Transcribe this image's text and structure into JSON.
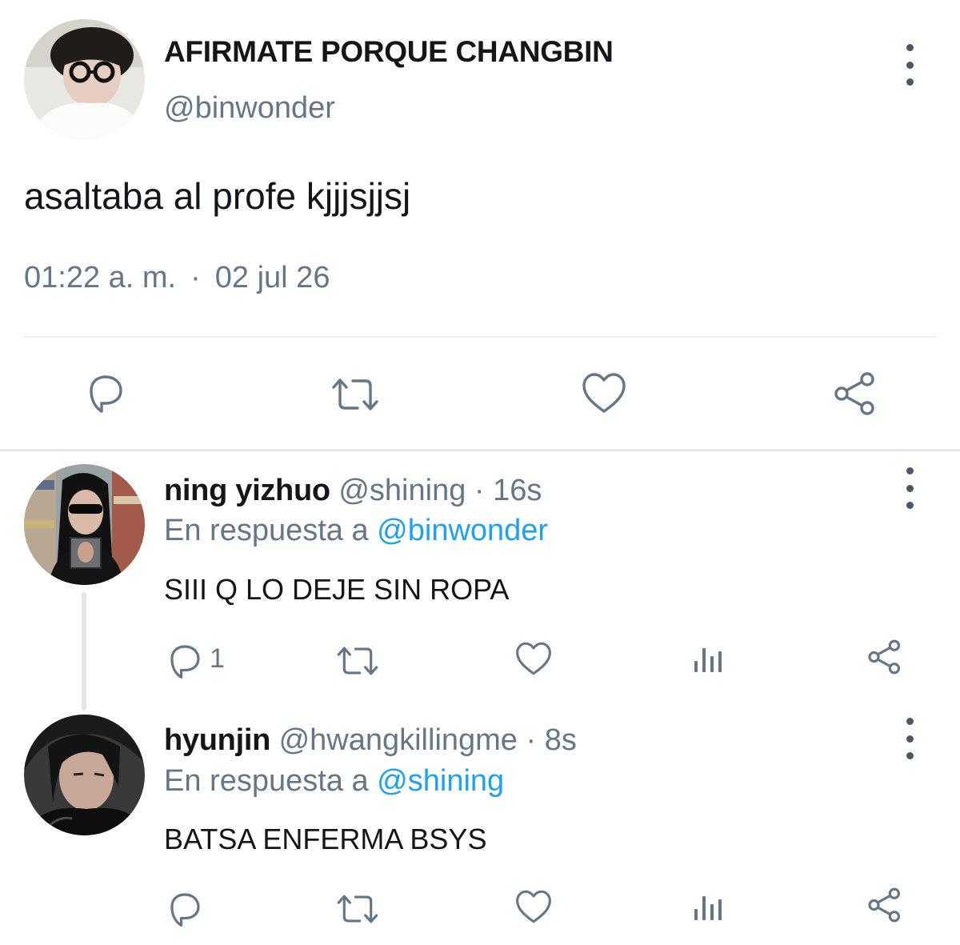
{
  "main_tweet": {
    "display_name": "AFIRMATE PORQUE CHANGBIN",
    "handle": "@binwonder",
    "text": "asaltaba al profe kjjjsjjsj",
    "time": "01:22 a. m.",
    "separator": "·",
    "date": "02 jul 26",
    "avatar": "avatar-binwonder"
  },
  "replies": [
    {
      "display_name": "ning yizhuo",
      "handle": "@shining",
      "separator": "·",
      "time": "16s",
      "reply_prefix": "En respuesta a",
      "reply_to": "@binwonder",
      "text": "SIII Q LO DEJE SIN ROPA",
      "reply_count": "1"
    },
    {
      "display_name": "hyunjin",
      "handle": "@hwangkillingme",
      "separator": "·",
      "time": "8s",
      "reply_prefix": "En respuesta a",
      "reply_to": "@shining",
      "text": "BATSA ENFERMA BSYS",
      "reply_count": ""
    }
  ],
  "icons": {
    "reply": "reply-icon",
    "retweet": "retweet-icon",
    "like": "like-icon",
    "share": "share-icon",
    "analytics": "analytics-icon",
    "more": "more-vertical-icon"
  },
  "colors": {
    "text": "#14171a",
    "secondary": "#657786",
    "link": "#1da1f2",
    "icon": "#657786",
    "divider": "#e6ecf0"
  }
}
